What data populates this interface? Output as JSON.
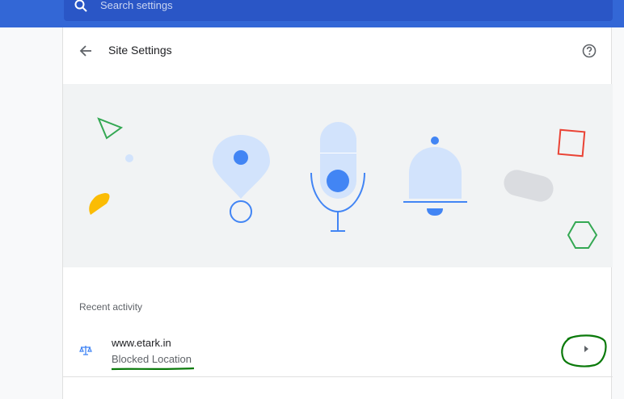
{
  "search": {
    "placeholder": "Search settings",
    "icon": "search-icon"
  },
  "header": {
    "title": "Site Settings",
    "back_icon": "back-arrow-icon",
    "help_icon": "help-icon"
  },
  "banner": {
    "icons": [
      "location-pin-icon",
      "microphone-icon",
      "notification-bell-icon"
    ]
  },
  "recent_activity": {
    "heading": "Recent activity",
    "items": [
      {
        "site": "www.etark.in",
        "status": "Blocked Location",
        "icon": "site-balance-icon",
        "arrow_icon": "arrow-right-icon"
      }
    ]
  },
  "colors": {
    "topbar": "#3367d6",
    "search_box": "#2a56c6",
    "banner_bg": "#f1f3f4",
    "accent_blue": "#4285f4",
    "light_blue": "#d2e3fc",
    "annotation_green": "#0b7a0b"
  }
}
